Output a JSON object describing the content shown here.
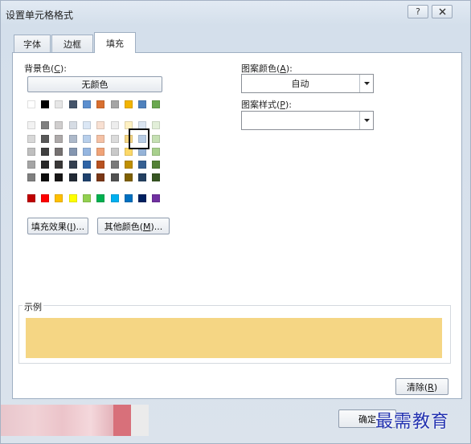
{
  "window": {
    "title": "设置单元格格式",
    "help_label": "?"
  },
  "tabs": [
    {
      "label": "字体",
      "active": false
    },
    {
      "label": "边框",
      "active": false
    },
    {
      "label": "填充",
      "active": true
    }
  ],
  "fill": {
    "background_color_label": "背景色(C):",
    "no_color_button": "无颜色",
    "fill_effects_button": "填充效果(I)...",
    "more_colors_button": "其他颜色(M)...",
    "selected_color": "#f5d684"
  },
  "pattern": {
    "color_label": "图案颜色(A):",
    "color_value": "自动",
    "style_label": "图案样式(P):",
    "style_value": ""
  },
  "sample": {
    "label": "示例",
    "color": "#f5d684"
  },
  "buttons": {
    "clear": "清除(R)",
    "ok": "确定"
  },
  "watermark": "最需教育",
  "palette": {
    "theme_top": [
      "#ffffff",
      "#000000",
      "#e6e6e6",
      "#44546a",
      "#5b8fcf",
      "#d86f30",
      "#a5a5a5",
      "#f2b400",
      "#4f81bd",
      "#6aa84f"
    ],
    "theme_shades": [
      [
        "#f2f2f2",
        "#7f7f7f",
        "#d0cece",
        "#d6dce4",
        "#dbe7f5",
        "#f8e0d2",
        "#ededed",
        "#fdf0c2",
        "#dbe5f1",
        "#e2efd9"
      ],
      [
        "#d8d8d8",
        "#595959",
        "#aeaaaa",
        "#adb9ca",
        "#b8cfeb",
        "#f4c1a5",
        "#dbdbdb",
        "#f5d684",
        "#b8cce4",
        "#c5e0b3"
      ],
      [
        "#bfbfbf",
        "#404040",
        "#757171",
        "#8496b0",
        "#95b6e0",
        "#f0a378",
        "#c9c9c9",
        "#fcd868",
        "#95b3d7",
        "#a8d08d"
      ],
      [
        "#a5a5a5",
        "#262626",
        "#3a3838",
        "#333f50",
        "#2e63a6",
        "#b85220",
        "#7b7b7b",
        "#bf8f00",
        "#366092",
        "#538135"
      ],
      [
        "#7f7f7f",
        "#0c0c0c",
        "#171616",
        "#222a35",
        "#1f426e",
        "#7a3716",
        "#525252",
        "#7f6000",
        "#244061",
        "#375623"
      ]
    ],
    "standard": [
      "#c00000",
      "#ff0000",
      "#ffc000",
      "#ffff00",
      "#92d050",
      "#00b050",
      "#00b0f0",
      "#0070c0",
      "#002060",
      "#7030a0"
    ]
  }
}
